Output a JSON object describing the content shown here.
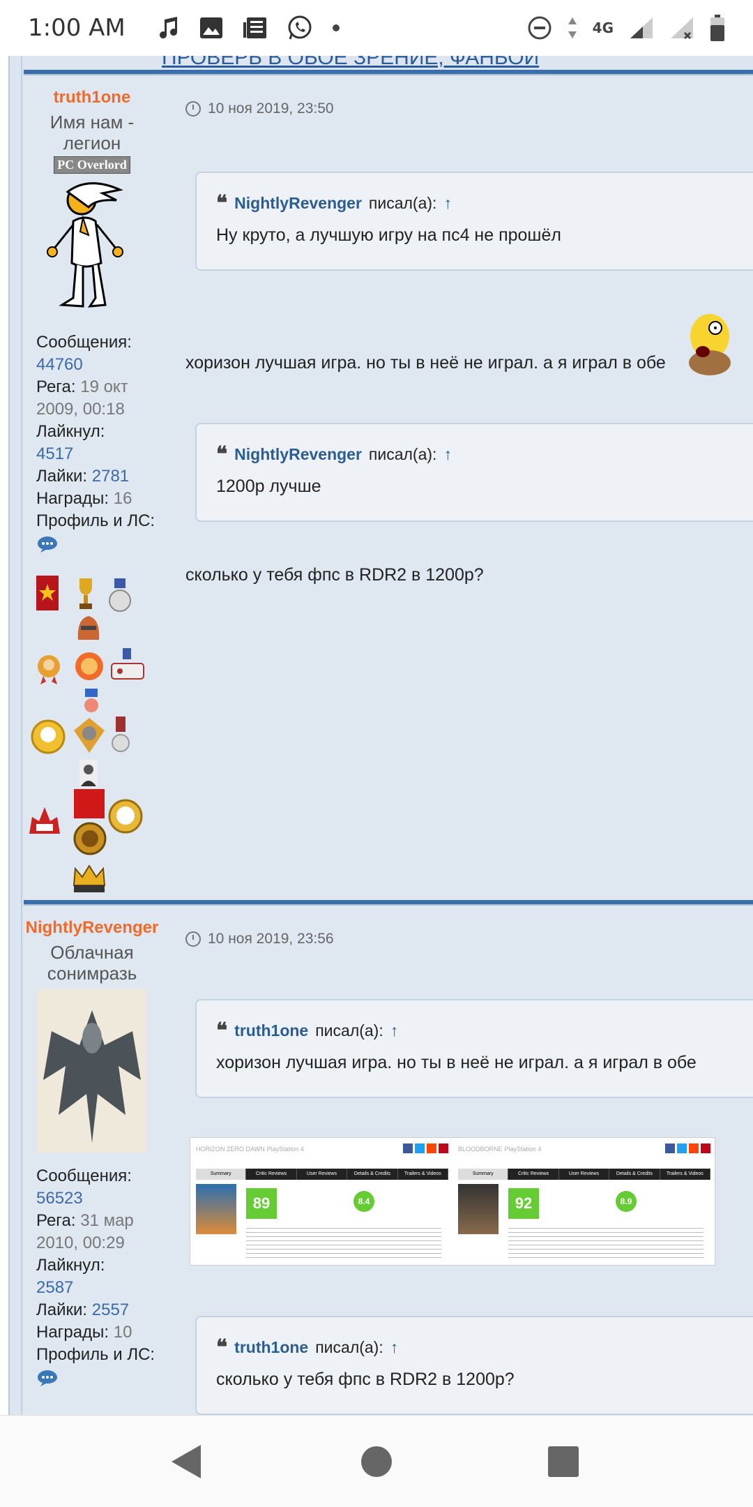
{
  "status": {
    "time": "1:00 AM",
    "network": "4G"
  },
  "top_link": "ПРОВЕРЬ В ОБОЕ ЗРЕНИЕ, ФАНБОИ",
  "posts": [
    {
      "author": "truth1one",
      "rank": "Имя нам - легион",
      "rank_badge": "PC Overlord",
      "date": "10 ноя 2019, 23:50",
      "stats": {
        "messages_label": "Сообщения:",
        "messages": "44760",
        "reg_label": "Рега:",
        "reg": "19 окт 2009, 00:18",
        "liked_label": "Лайкнул:",
        "liked": "4517",
        "likes_label": "Лайки:",
        "likes": "2781",
        "awards_label": "Награды:",
        "awards": "16",
        "profile_label": "Профиль и ЛС:"
      },
      "quote1": {
        "author": "NightlyRevenger",
        "said": "писал(а):",
        "arrow": "↑",
        "text": "Ну круто, а лучшую игру на пс4 не прошёл"
      },
      "text1": "хоризон лучшая игра. но ты в неё не играл. а я играл в обе",
      "quote2": {
        "author": "NightlyRevenger",
        "said": "писал(а):",
        "arrow": "↑",
        "text": "1200р лучше"
      },
      "text2": "сколько у тебя фпс в RDR2 в 1200р?"
    },
    {
      "author": "NightlyRevenger",
      "rank": "Облачная сонимразь",
      "date": "10 ноя 2019, 23:56",
      "stats": {
        "messages_label": "Сообщения:",
        "messages": "56523",
        "reg_label": "Рега:",
        "reg": "31 мар 2010, 00:29",
        "liked_label": "Лайкнул:",
        "liked": "2587",
        "likes_label": "Лайки:",
        "likes": "2557",
        "awards_label": "Награды:",
        "awards": "10",
        "profile_label": "Профиль и ЛС:"
      },
      "quote1": {
        "author": "truth1one",
        "said": "писал(а):",
        "arrow": "↑",
        "text": "хоризон лучшая игра. но ты в неё не играл. а я играл в обе"
      },
      "quote2": {
        "author": "truth1one",
        "said": "писал(а):",
        "arrow": "↑",
        "text": "сколько у тебя фпс в RDR2 в 1200р?"
      },
      "metacritic": [
        {
          "title": "HORIZON ZERO DAWN",
          "platform": "PlayStation 4",
          "metascore": "89",
          "userscore": "8.4",
          "tabs": [
            "Summary",
            "Critic Reviews",
            "User Reviews",
            "Details & Credits",
            "Trailers & Videos"
          ]
        },
        {
          "title": "BLOODBORNE",
          "platform": "PlayStation 4",
          "metascore": "92",
          "userscore": "8.9",
          "tabs": [
            "Summary",
            "Critic Reviews",
            "User Reviews",
            "Details & Credits",
            "Trailers & Videos"
          ]
        }
      ]
    }
  ],
  "colors": {
    "accent": "#3c6ea8",
    "username": "#f06a2b",
    "link": "#2b5d90"
  }
}
